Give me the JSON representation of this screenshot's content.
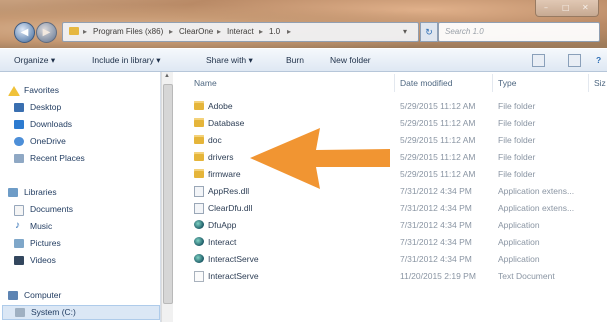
{
  "window": {
    "controls": [
      "–",
      "□",
      "✕"
    ]
  },
  "address": {
    "crumbs": [
      "Program Files (x86)",
      "ClearOne",
      "Interact",
      "1.0"
    ],
    "separator": "▸",
    "search_placeholder": "Search 1.0"
  },
  "toolbar": {
    "organize": "Organize ▾",
    "include": "Include in library ▾",
    "share": "Share with ▾",
    "burn": "Burn",
    "new_folder": "New folder"
  },
  "nav": {
    "favorites": "Favorites",
    "desktop": "Desktop",
    "downloads": "Downloads",
    "onedrive": "OneDrive",
    "recent": "Recent Places",
    "libraries": "Libraries",
    "documents": "Documents",
    "music": "Music",
    "pictures": "Pictures",
    "videos": "Videos",
    "computer": "Computer",
    "system": "System (C:)"
  },
  "columns": {
    "name": "Name",
    "date": "Date modified",
    "type": "Type",
    "size": "Siz"
  },
  "files": [
    {
      "name": "Adobe",
      "date": "5/29/2015 11:12 AM",
      "type": "File folder",
      "icon": "folder-icon"
    },
    {
      "name": "Database",
      "date": "5/29/2015 11:12 AM",
      "type": "File folder",
      "icon": "folder-icon"
    },
    {
      "name": "doc",
      "date": "5/29/2015 11:12 AM",
      "type": "File folder",
      "icon": "folder-icon"
    },
    {
      "name": "drivers",
      "date": "5/29/2015 11:12 AM",
      "type": "File folder",
      "icon": "folder-icon"
    },
    {
      "name": "firmware",
      "date": "5/29/2015 11:12 AM",
      "type": "File folder",
      "icon": "folder-icon"
    },
    {
      "name": "AppRes.dll",
      "date": "7/31/2012 4:34 PM",
      "type": "Application extens...",
      "icon": "dll-icon"
    },
    {
      "name": "ClearDfu.dll",
      "date": "7/31/2012 4:34 PM",
      "type": "Application extens...",
      "icon": "dll-icon"
    },
    {
      "name": "DfuApp",
      "date": "7/31/2012 4:34 PM",
      "type": "Application",
      "icon": "app-icon"
    },
    {
      "name": "Interact",
      "date": "7/31/2012 4:34 PM",
      "type": "Application",
      "icon": "app-icon"
    },
    {
      "name": "InteractServe",
      "date": "7/31/2012 4:34 PM",
      "type": "Application",
      "icon": "app-icon"
    },
    {
      "name": "InteractServe",
      "date": "11/20/2015 2:19 PM",
      "type": "Text Document",
      "icon": "text-document-icon"
    }
  ],
  "colors": {
    "arrow": "#f08a1c",
    "folder": "#e5b53a",
    "toolbar_text": "#1d2f48"
  }
}
